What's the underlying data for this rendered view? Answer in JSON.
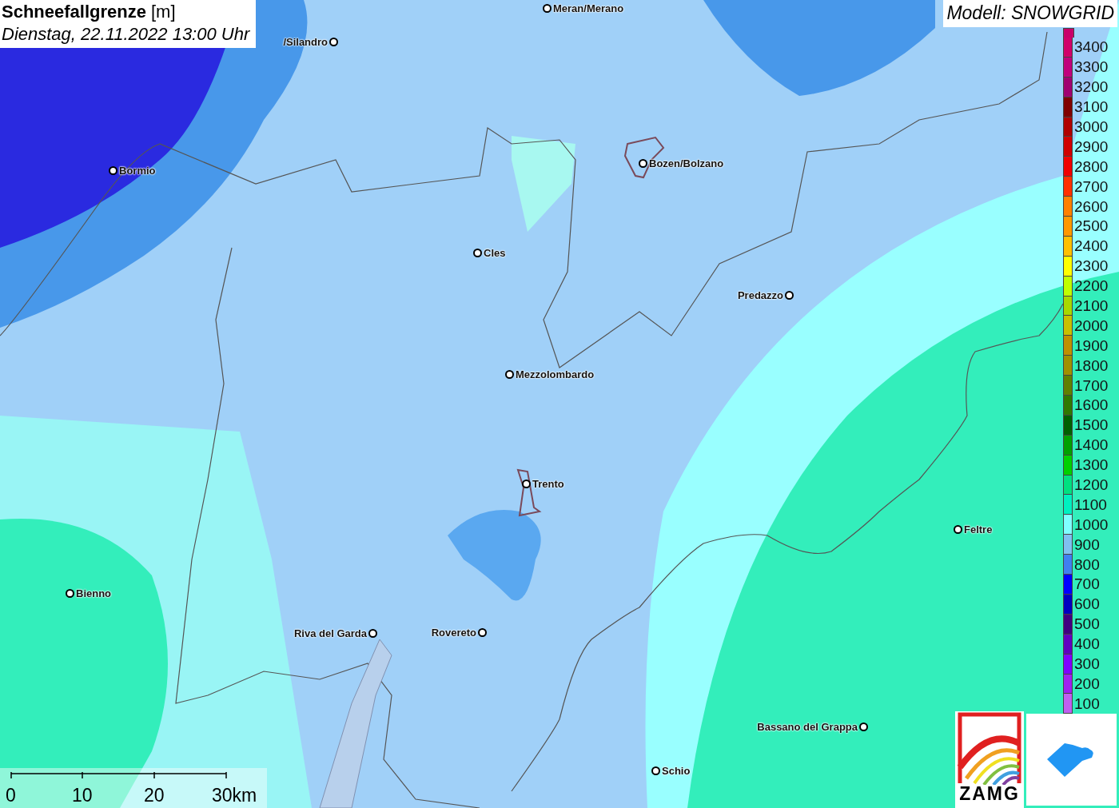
{
  "title": {
    "name": "Schneefallgrenze",
    "unit": "[m]",
    "datetime": "Dienstag, 22.11.2022 13:00 Uhr"
  },
  "model": "Modell: SNOWGRID",
  "cities": [
    {
      "name": "Meran/Merano"
    },
    {
      "name": "/Silandro"
    },
    {
      "name": "Bormio"
    },
    {
      "name": "Bozen/Bolzano"
    },
    {
      "name": "Cles"
    },
    {
      "name": "Predazzo"
    },
    {
      "name": "Mezzolombardo"
    },
    {
      "name": "Trento"
    },
    {
      "name": "Feltre"
    },
    {
      "name": "Bienno"
    },
    {
      "name": "Riva del Garda"
    },
    {
      "name": "Rovereto"
    },
    {
      "name": "Bassano del Grappa"
    },
    {
      "name": "Schio"
    }
  ],
  "legend": [
    {
      "label": "3400",
      "color": "#d0006a"
    },
    {
      "label": "3300",
      "color": "#c0007c"
    },
    {
      "label": "3200",
      "color": "#a00070"
    },
    {
      "label": "3100",
      "color": "#800000"
    },
    {
      "label": "3000",
      "color": "#b00000"
    },
    {
      "label": "2900",
      "color": "#d00000"
    },
    {
      "label": "2800",
      "color": "#f00000"
    },
    {
      "label": "2700",
      "color": "#ff3000"
    },
    {
      "label": "2600",
      "color": "#ff8000"
    },
    {
      "label": "2500",
      "color": "#ff9800"
    },
    {
      "label": "2400",
      "color": "#ffc000"
    },
    {
      "label": "2300",
      "color": "#ffff00"
    },
    {
      "label": "2200",
      "color": "#c0ff00"
    },
    {
      "label": "2100",
      "color": "#a8d800"
    },
    {
      "label": "2000",
      "color": "#c8c000"
    },
    {
      "label": "1900",
      "color": "#c09000"
    },
    {
      "label": "1800",
      "color": "#a09000"
    },
    {
      "label": "1700",
      "color": "#608000"
    },
    {
      "label": "1600",
      "color": "#307800"
    },
    {
      "label": "1500",
      "color": "#006000"
    },
    {
      "label": "1400",
      "color": "#00a000"
    },
    {
      "label": "1300",
      "color": "#00d000"
    },
    {
      "label": "1200",
      "color": "#00e080"
    },
    {
      "label": "1100",
      "color": "#00f0c0"
    },
    {
      "label": "1000",
      "color": "#80ffff"
    },
    {
      "label": "900",
      "color": "#80c0f0"
    },
    {
      "label": "800",
      "color": "#4080f0"
    },
    {
      "label": "700",
      "color": "#0000ff"
    },
    {
      "label": "600",
      "color": "#0000c0"
    },
    {
      "label": "500",
      "color": "#400080"
    },
    {
      "label": "400",
      "color": "#6000c0"
    },
    {
      "label": "300",
      "color": "#8000ff"
    },
    {
      "label": "200",
      "color": "#a020f0"
    },
    {
      "label": "100",
      "color": "#c060f0"
    }
  ],
  "scale": [
    "0",
    "10",
    "20",
    "30km"
  ],
  "logo_text": "ZAMG"
}
